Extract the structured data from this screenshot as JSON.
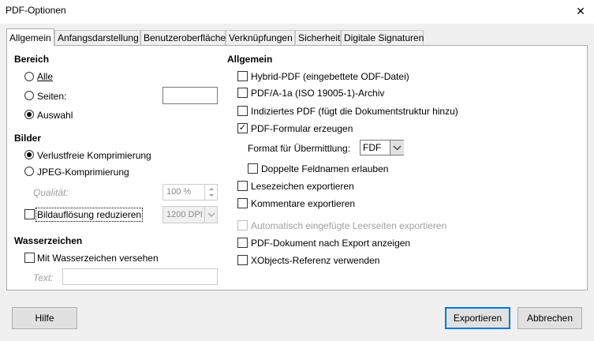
{
  "window": {
    "title": "PDF-Optionen",
    "close_glyph": "✕"
  },
  "tabs": [
    {
      "label": "Allgemein"
    },
    {
      "label": "Anfangsdarstellung"
    },
    {
      "label": "Benutzeroberfläche"
    },
    {
      "label": "Verknüpfungen"
    },
    {
      "label": "Sicherheit"
    },
    {
      "label": "Digitale Signaturen"
    }
  ],
  "bereich": {
    "heading": "Bereich",
    "alle": "Alle",
    "seiten": "Seiten:",
    "auswahl": "Auswahl",
    "selected": "Auswahl"
  },
  "bilder": {
    "heading": "Bilder",
    "verlustfrei": "Verlustfreie Komprimierung",
    "jpeg": "JPEG-Komprimierung",
    "qualitaet_label": "Qualität:",
    "qualitaet_value": "100 %",
    "reduce_label": "Bildauflösung reduzieren",
    "dpi_value": "1200 DPI",
    "selected": "Verlustfreie Komprimierung"
  },
  "wasserzeichen": {
    "heading": "Wasserzeichen",
    "mit": "Mit Wasserzeichen versehen",
    "text_label": "Text:"
  },
  "allgemein": {
    "heading": "Allgemein",
    "hybrid": "Hybrid-PDF (eingebettete ODF-Datei)",
    "pdfa": "PDF/A-1a (ISO 19005-1)-Archiv",
    "indiziert": "Indiziertes PDF (fügt die Dokumentstruktur hinzu)",
    "formular": "PDF-Formular erzeugen",
    "formular_checked": true,
    "format_label": "Format für Übermittlung:",
    "format_value": "FDF",
    "doppelte": "Doppelte Feldnamen erlauben",
    "lesezeichen": "Lesezeichen exportieren",
    "kommentare": "Kommentare exportieren",
    "leerseiten": "Automatisch eingefügte Leerseiten exportieren",
    "anzeigen": "PDF-Dokument nach Export anzeigen",
    "xobjects": "XObjects-Referenz verwenden"
  },
  "buttons": {
    "hilfe": "Hilfe",
    "exportieren": "Exportieren",
    "abbrechen": "Abbrechen"
  },
  "icons": {
    "check": "✓",
    "dropdown": "chevron-down-icon",
    "close": "close-icon"
  }
}
